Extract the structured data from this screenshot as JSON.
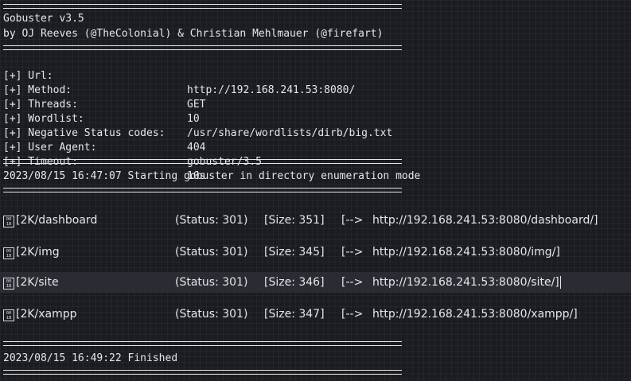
{
  "banner": {
    "title": "Gobuster v3.5",
    "authors": "by OJ Reeves (@TheColonial) & Christian Mehlmauer (@firefart)"
  },
  "config": [
    {
      "key": "[+] Url:",
      "value": "http://192.168.241.53:8080/"
    },
    {
      "key": "[+] Method:",
      "value": "GET"
    },
    {
      "key": "[+] Threads:",
      "value": "10"
    },
    {
      "key": "[+] Wordlist:",
      "value": "/usr/share/wordlists/dirb/big.txt"
    },
    {
      "key": "[+] Negative Status codes:",
      "value": "404"
    },
    {
      "key": "[+] User Agent:",
      "value": "gobuster/3.5"
    },
    {
      "key": "[+] Timeout:",
      "value": "10s"
    }
  ],
  "start_message": "2023/08/15 16:47:07 Starting gobuster in directory enumeration mode",
  "results": [
    {
      "glyph": [
        "00",
        "1B"
      ],
      "path": "[2K/dashboard",
      "status": "(Status: 301)",
      "size": "[Size: 351]",
      "arrow": "[-->",
      "url": "http://192.168.241.53:8080/dashboard/]"
    },
    {
      "glyph": [
        "00",
        "1B"
      ],
      "path": "[2K/img",
      "status": "(Status: 301)",
      "size": "[Size: 345]",
      "arrow": "[-->",
      "url": "http://192.168.241.53:8080/img/]"
    },
    {
      "glyph": [
        "00",
        "1B"
      ],
      "path": "[2K/site",
      "status": "(Status: 301)",
      "size": "[Size: 346]",
      "arrow": "[-->",
      "url": "http://192.168.241.53:8080/site/]"
    },
    {
      "glyph": [
        "00",
        "1B"
      ],
      "path": "[2K/xampp",
      "status": "(Status: 301)",
      "size": "[Size: 347]",
      "arrow": "[-->",
      "url": "http://192.168.241.53:8080/xampp/]"
    }
  ],
  "finish_message": "2023/08/15 16:49:22 Finished",
  "colors": {
    "background": "#1b1c22",
    "text": "#e6e6e6",
    "highlight_row": "#2b2c33"
  }
}
